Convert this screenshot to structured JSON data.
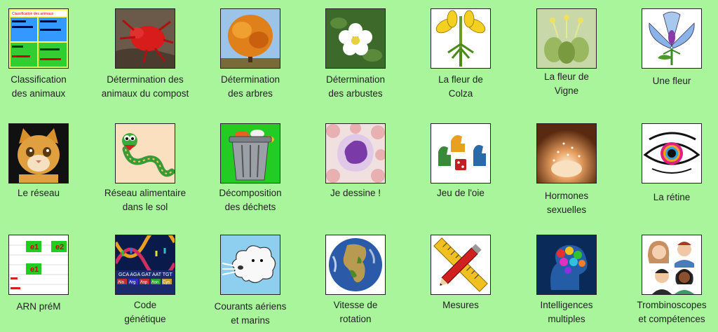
{
  "tiles": [
    {
      "label": "Classification\ndes animaux",
      "icon": "classification-table-icon"
    },
    {
      "label": "Détermination des\nanimaux du compost",
      "icon": "red-mite-icon"
    },
    {
      "label": "Détermination\ndes arbres",
      "icon": "autumn-tree-icon"
    },
    {
      "label": "Détermination\ndes arbustes",
      "icon": "white-flower-shrub-icon"
    },
    {
      "label": "La fleur de\nColza",
      "icon": "rapeseed-flower-icon"
    },
    {
      "label": "La fleur de\nVigne",
      "icon": "vine-flower-icon"
    },
    {
      "label": "Une fleur",
      "icon": "flower-diagram-icon"
    },
    {
      "label": "Le réseau",
      "icon": "kitten-icon"
    },
    {
      "label": "Réseau alimentaire\ndans le sol",
      "icon": "worm-icon"
    },
    {
      "label": "Décomposition\ndes déchets",
      "icon": "trash-can-icon"
    },
    {
      "label": "Je dessine !",
      "icon": "blood-cell-icon"
    },
    {
      "label": "Jeu de l'oie",
      "icon": "game-pieces-icon"
    },
    {
      "label": "Hormones\nsexuelles",
      "icon": "cell-burst-icon"
    },
    {
      "label": "La rétine",
      "icon": "eye-icon"
    },
    {
      "label": "ARN préM",
      "icon": "rna-exon-icon"
    },
    {
      "label": "Code\ngénétique",
      "icon": "dna-helix-icon"
    },
    {
      "label": "Courants aériens\net marins",
      "icon": "wind-cloud-icon"
    },
    {
      "label": "Vitesse de\nrotation",
      "icon": "earth-globe-icon"
    },
    {
      "label": "Mesures",
      "icon": "ruler-pencil-icon"
    },
    {
      "label": "Intelligences\nmultiples",
      "icon": "brain-icon"
    },
    {
      "label": "Trombinoscopes\net compétences",
      "icon": "people-faces-icon"
    }
  ],
  "classification": {
    "header": "Classification des animaux",
    "cells": [
      "groupe",
      "caractère",
      "sous-groupe",
      "caractère"
    ]
  },
  "dna": {
    "sequence": "GCA AGA GAT AAT TGT",
    "amino_acids": [
      "Ala",
      "Arg",
      "Asp",
      "Asn",
      "Cys"
    ]
  },
  "rna": {
    "exons": [
      "e1",
      "e2",
      "e1"
    ]
  }
}
